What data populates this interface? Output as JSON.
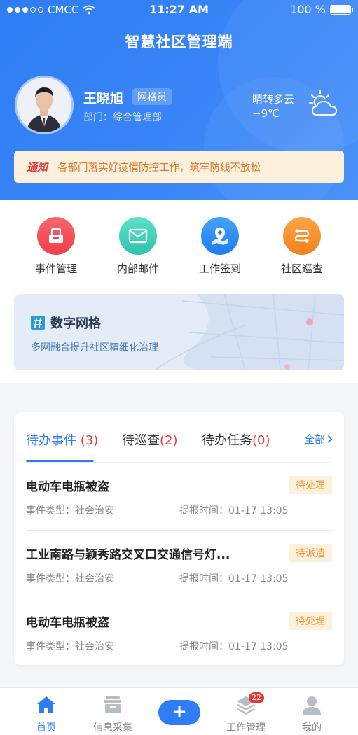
{
  "status_bar": {
    "carrier": "CMCC",
    "time": "11:27 AM",
    "battery": "100 %"
  },
  "app": {
    "title": "智慧社区管理端"
  },
  "user": {
    "name": "王晓旭",
    "role": "网格员",
    "department": "部门：综合管理部"
  },
  "weather": {
    "condition": "晴转多云",
    "temperature": "−9℃",
    "icon": "cloudy-sun-icon"
  },
  "notice": {
    "tag": "通知",
    "text": "各部门落实好疫情防控工作，筑牢防线不放松"
  },
  "functions": [
    {
      "label": "事件管理",
      "icon": "event-icon",
      "color": "#f0525a"
    },
    {
      "label": "内部邮件",
      "icon": "mail-icon",
      "color": "#3ccfb7"
    },
    {
      "label": "工作签到",
      "icon": "map-pin-icon",
      "color": "#2f8ef5"
    },
    {
      "label": "社区巡查",
      "icon": "route-icon",
      "color": "#f7902a"
    }
  ],
  "digital_grid": {
    "title": "数字网格",
    "subtitle": "多网融合提升社区精细化治理"
  },
  "tabs": [
    {
      "label": "待办事件",
      "count": "(3)"
    },
    {
      "label": "待巡查",
      "count": "(2)"
    },
    {
      "label": "待办任务",
      "count": "(0)"
    }
  ],
  "tab_all": "全部",
  "tasks": [
    {
      "title": "电动车电瓶被盗",
      "status": "待处理",
      "type": "事件类型：社会治安",
      "time": "提报时间：01-17  13:05"
    },
    {
      "title": "工业南路与颖秀路交叉口交通信号灯...",
      "status": "待派遣",
      "type": "事件类型：社会治安",
      "time": "提报时间：01-17  13:05"
    },
    {
      "title": "电动车电瓶被盗",
      "status": "待处理",
      "type": "事件类型：社会治安",
      "time": "提报时间：01-17  13:05"
    }
  ],
  "bottom_nav": {
    "home": "首页",
    "collect": "信息采集",
    "plus": "+",
    "work": "工作管理",
    "work_badge": "22",
    "me": "我的"
  },
  "colors": {
    "primary": "#2f7df5",
    "danger": "#e53935",
    "warning": "#e9962e"
  }
}
